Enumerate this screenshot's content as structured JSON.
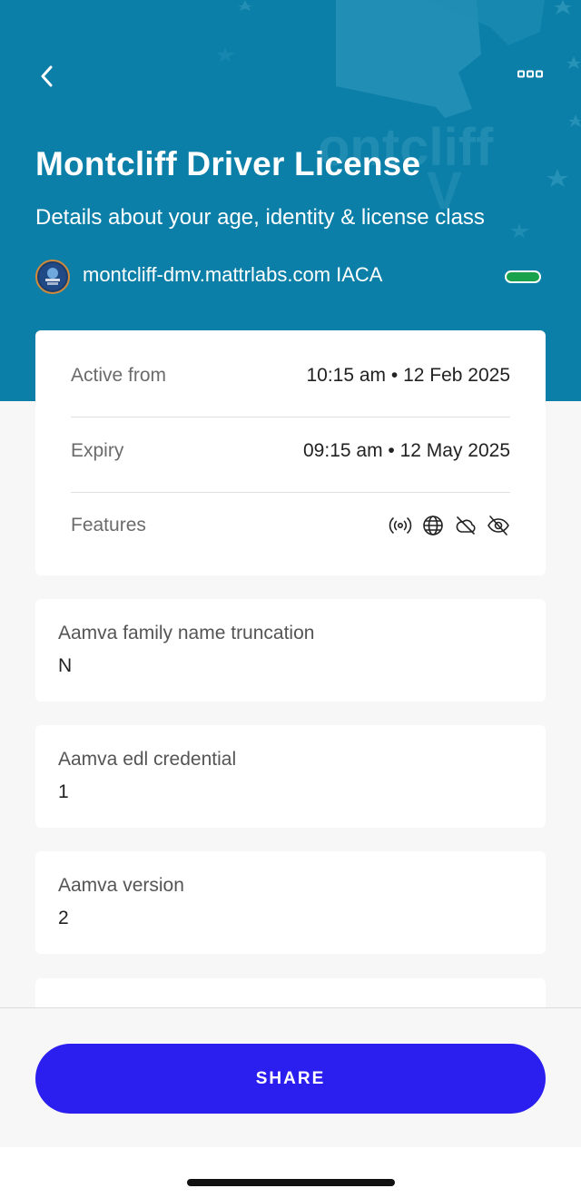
{
  "header": {
    "title": "Montcliff Driver License",
    "subtitle": "Details about your age, identity & license class",
    "issuer": "montcliff-dmv.mattrlabs.com IACA",
    "background_color": "#0b7fa8",
    "status_color": "#1aa14b"
  },
  "icons": {
    "back": "chevron-left-icon",
    "more": "more-horizontal-icon",
    "features": [
      "broadcast-icon",
      "globe-icon",
      "cloud-off-icon",
      "eye-off-icon"
    ]
  },
  "meta": {
    "active_from_label": "Active from",
    "active_from_value": "10:15 am • 12 Feb 2025",
    "expiry_label": "Expiry",
    "expiry_value": "09:15 am • 12 May 2025",
    "features_label": "Features"
  },
  "fields": [
    {
      "label": "Aamva family name truncation",
      "value": "N"
    },
    {
      "label": "Aamva edl credential",
      "value": "1"
    },
    {
      "label": "Aamva version",
      "value": "2"
    }
  ],
  "footer": {
    "share_label": "SHARE",
    "share_color": "#2b1ff0"
  }
}
